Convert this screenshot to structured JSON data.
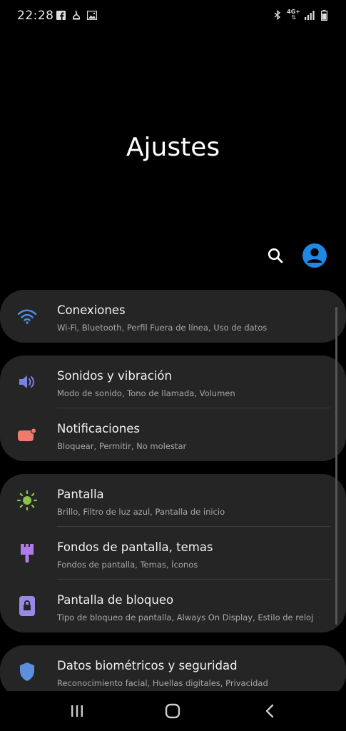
{
  "status_bar": {
    "time": "22:28",
    "network_label": "4G+",
    "left_icons": [
      "facebook-icon",
      "notification-app-icon",
      "image-icon"
    ],
    "right_icons": [
      "bluetooth-icon",
      "network-icon",
      "signal-icon",
      "battery-icon"
    ]
  },
  "header": {
    "title": "Ajustes",
    "actions": [
      "search-icon",
      "account-icon"
    ],
    "account_color": "#1e88e5"
  },
  "groups": [
    {
      "items": [
        {
          "title": "Conexiones",
          "subtitle": "Wi-Fi, Bluetooth, Perfil Fuera de línea, Uso de datos",
          "icon": "wifi-icon",
          "color": "#4a90e2"
        }
      ]
    },
    {
      "items": [
        {
          "title": "Sonidos y vibración",
          "subtitle": "Modo de sonido, Tono de llamada, Volumen",
          "icon": "volume-icon",
          "color": "#7b7fe6"
        },
        {
          "title": "Notificaciones",
          "subtitle": "Bloquear, Permitir, No molestar",
          "icon": "notification-icon",
          "color": "#ef7a6e"
        }
      ]
    },
    {
      "items": [
        {
          "title": "Pantalla",
          "subtitle": "Brillo, Filtro de luz azul, Pantalla de inicio",
          "icon": "brightness-icon",
          "color": "#8bc34a"
        },
        {
          "title": "Fondos de pantalla, temas",
          "subtitle": "Fondos de pantalla, Temas, Íconos",
          "icon": "brush-icon",
          "color": "#b07be8"
        },
        {
          "title": "Pantalla de bloqueo",
          "subtitle": "Tipo de bloqueo de pantalla, Always On Display, Estilo de reloj",
          "icon": "lock-icon",
          "color": "#9a88e8"
        }
      ]
    },
    {
      "items": [
        {
          "title": "Datos biométricos y seguridad",
          "subtitle": "Reconocimiento facial, Huellas digitales, Privacidad",
          "icon": "shield-icon",
          "color": "#5c8fdc"
        }
      ]
    }
  ],
  "nav_bar": {
    "buttons": [
      "recents-icon",
      "home-icon",
      "back-icon"
    ]
  }
}
